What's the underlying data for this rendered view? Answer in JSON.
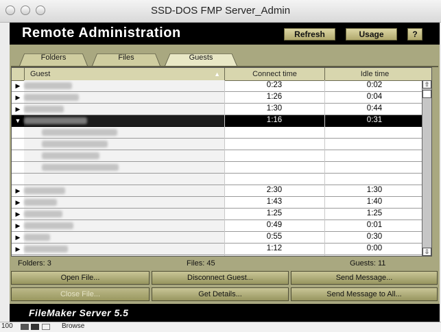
{
  "window": {
    "title": "SSD-DOS FMP Server_Admin"
  },
  "header": {
    "title": "Remote Administration",
    "refresh_label": "Refresh",
    "usage_label": "Usage",
    "help_label": "?"
  },
  "tabs": [
    {
      "label": "Folders",
      "active": false
    },
    {
      "label": "Files",
      "active": false
    },
    {
      "label": "Guests",
      "active": true
    }
  ],
  "table": {
    "columns": [
      "Guest",
      "Connect time",
      "Idle time"
    ],
    "sort_indicator": "▲",
    "rows": [
      {
        "expand": "collapsed",
        "connect": "0:23",
        "idle": "0:02"
      },
      {
        "expand": "collapsed",
        "connect": "1:26",
        "idle": "0:04"
      },
      {
        "expand": "collapsed",
        "connect": "1:30",
        "idle": "0:44"
      },
      {
        "expand": "expanded",
        "connect": "1:16",
        "idle": "0:31",
        "selected": true
      },
      {
        "expand": "child",
        "connect": "",
        "idle": ""
      },
      {
        "expand": "child",
        "connect": "",
        "idle": ""
      },
      {
        "expand": "child",
        "connect": "",
        "idle": ""
      },
      {
        "expand": "child",
        "connect": "",
        "idle": ""
      },
      {
        "expand": "blank",
        "connect": "",
        "idle": ""
      },
      {
        "expand": "collapsed",
        "connect": "2:30",
        "idle": "1:30"
      },
      {
        "expand": "collapsed",
        "connect": "1:43",
        "idle": "1:40"
      },
      {
        "expand": "collapsed",
        "connect": "1:25",
        "idle": "1:25"
      },
      {
        "expand": "collapsed",
        "connect": "0:49",
        "idle": "0:01"
      },
      {
        "expand": "collapsed",
        "connect": "0:55",
        "idle": "0:30"
      },
      {
        "expand": "collapsed",
        "connect": "1:12",
        "idle": "0:00"
      }
    ]
  },
  "stats": {
    "folders": "Folders: 3",
    "files": "Files: 45",
    "guests": "Guests: 11"
  },
  "actions": {
    "open_file": "Open File...",
    "disconnect_guest": "Disconnect Guest...",
    "send_message": "Send Message...",
    "close_file": "Close File...",
    "get_details": "Get Details...",
    "send_message_all": "Send Message to All..."
  },
  "footer": {
    "brand": "FileMaker Server 5.5"
  },
  "statusbar": {
    "zoom": "100",
    "mode": "Browse"
  },
  "colors": {
    "panel": "#a9a880",
    "header": "#000000",
    "selected_row": "#000000"
  }
}
